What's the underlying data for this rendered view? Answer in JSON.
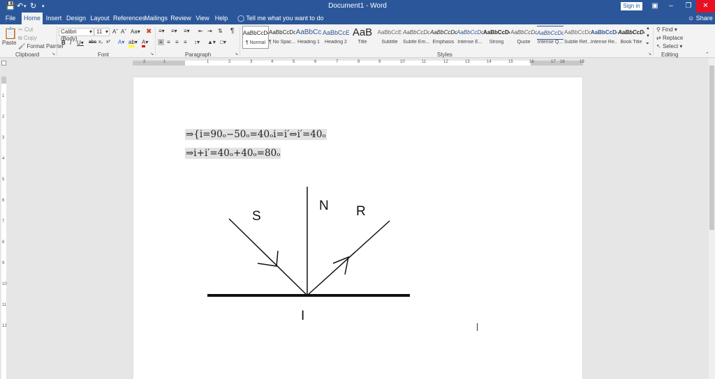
{
  "titlebar": {
    "title": "Document1  -  Word",
    "signin": "Sign in",
    "save_icon": "save-icon",
    "undo_icon": "undo-icon",
    "redo_icon": "redo-icon",
    "accent": "#2b579a"
  },
  "tabs": [
    "File",
    "Home",
    "Insert",
    "Design",
    "Layout",
    "References",
    "Mailings",
    "Review",
    "View",
    "Help"
  ],
  "active_tab": "Home",
  "tellme": "Tell me what you want to do",
  "share": "Share",
  "clipboard": {
    "paste": "Paste",
    "cut": "Cut",
    "copy": "Copy",
    "format_painter": "Format Painter",
    "label": "Clipboard"
  },
  "font": {
    "name": "Calibri (Body)",
    "size": "11",
    "label": "Font"
  },
  "paragraph": {
    "label": "Paragraph"
  },
  "styles": {
    "label": "Styles",
    "items": [
      {
        "preview": "AaBbCcDc",
        "name": "¶ Normal"
      },
      {
        "preview": "AaBbCcDc",
        "name": "¶ No Spac..."
      },
      {
        "preview": "AaBbCc",
        "name": "Heading 1"
      },
      {
        "preview": "AaBbCcE",
        "name": "Heading 2"
      },
      {
        "preview": "AaB",
        "name": "Title"
      },
      {
        "preview": "AaBbCcE",
        "name": "Subtitle"
      },
      {
        "preview": "AaBbCcDc",
        "name": "Subtle Em..."
      },
      {
        "preview": "AaBbCcDc",
        "name": "Emphasis"
      },
      {
        "preview": "AaBbCcDc",
        "name": "Intense E..."
      },
      {
        "preview": "AaBbCcDc",
        "name": "Strong"
      },
      {
        "preview": "AaBbCcDc",
        "name": "Quote"
      },
      {
        "preview": "AaBbCcDc",
        "name": "Intense Q..."
      },
      {
        "preview": "AaBbCcDc",
        "name": "Subtle Ref..."
      },
      {
        "preview": "AaBbCcDc",
        "name": "Intense Re..."
      },
      {
        "preview": "AaBbCcDc",
        "name": "Book Title"
      }
    ]
  },
  "editing": {
    "find": "Find",
    "replace": "Replace",
    "select": "Select",
    "label": "Editing"
  },
  "ruler": {
    "numbers": [
      "1",
      "2",
      "1",
      "2",
      "3",
      "4",
      "5",
      "6",
      "7",
      "8",
      "9",
      "10",
      "11",
      "12",
      "13",
      "14",
      "15",
      "16",
      "17",
      "18",
      "19"
    ],
    "left_numbers": [
      "1",
      "2",
      "3",
      "4",
      "5",
      "6",
      "7",
      "8",
      "9",
      "10",
      "11",
      "12"
    ]
  },
  "document": {
    "eq1": "⇒{i=90ₒ−50ₒ=40ₒi=i′⇔i′=40ₒ",
    "eq2": "⇒i+i′=40ₒ+40ₒ=80ₒ",
    "labels": {
      "S": "S",
      "N": "N",
      "R": "R",
      "I": "I"
    }
  }
}
